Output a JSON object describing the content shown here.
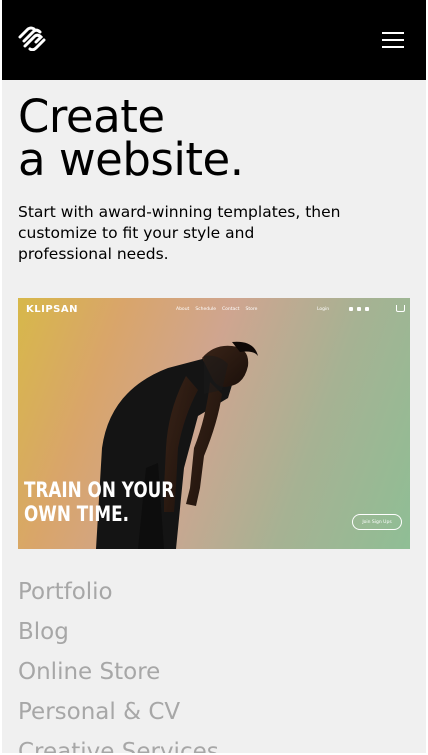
{
  "header": {
    "logo_icon": "squarespace-logo-icon",
    "menu_icon": "hamburger-menu-icon"
  },
  "hero_copy": {
    "headline_line1": "Create",
    "headline_line2": "a website.",
    "subtext": "Start with award-winning templates, then customize to fit your style and professional needs."
  },
  "template_preview": {
    "brand": "KLIPSAN",
    "nav": [
      "About",
      "Schedule",
      "Contact",
      "Store"
    ],
    "login": "Login",
    "social_icons": [
      "instagram-icon",
      "youtube-icon",
      "facebook-icon"
    ],
    "cart_icon": "cart-icon",
    "tagline_line1": "TRAIN ON YOUR",
    "tagline_line2": "OWN TIME.",
    "cta": "Join Sign Ups"
  },
  "categories": [
    "Portfolio",
    "Blog",
    "Online Store",
    "Personal & CV",
    "Creative Services"
  ],
  "colors": {
    "topbar": "#000000",
    "background": "#f0f0f0",
    "category_text": "#a7a7a7"
  }
}
